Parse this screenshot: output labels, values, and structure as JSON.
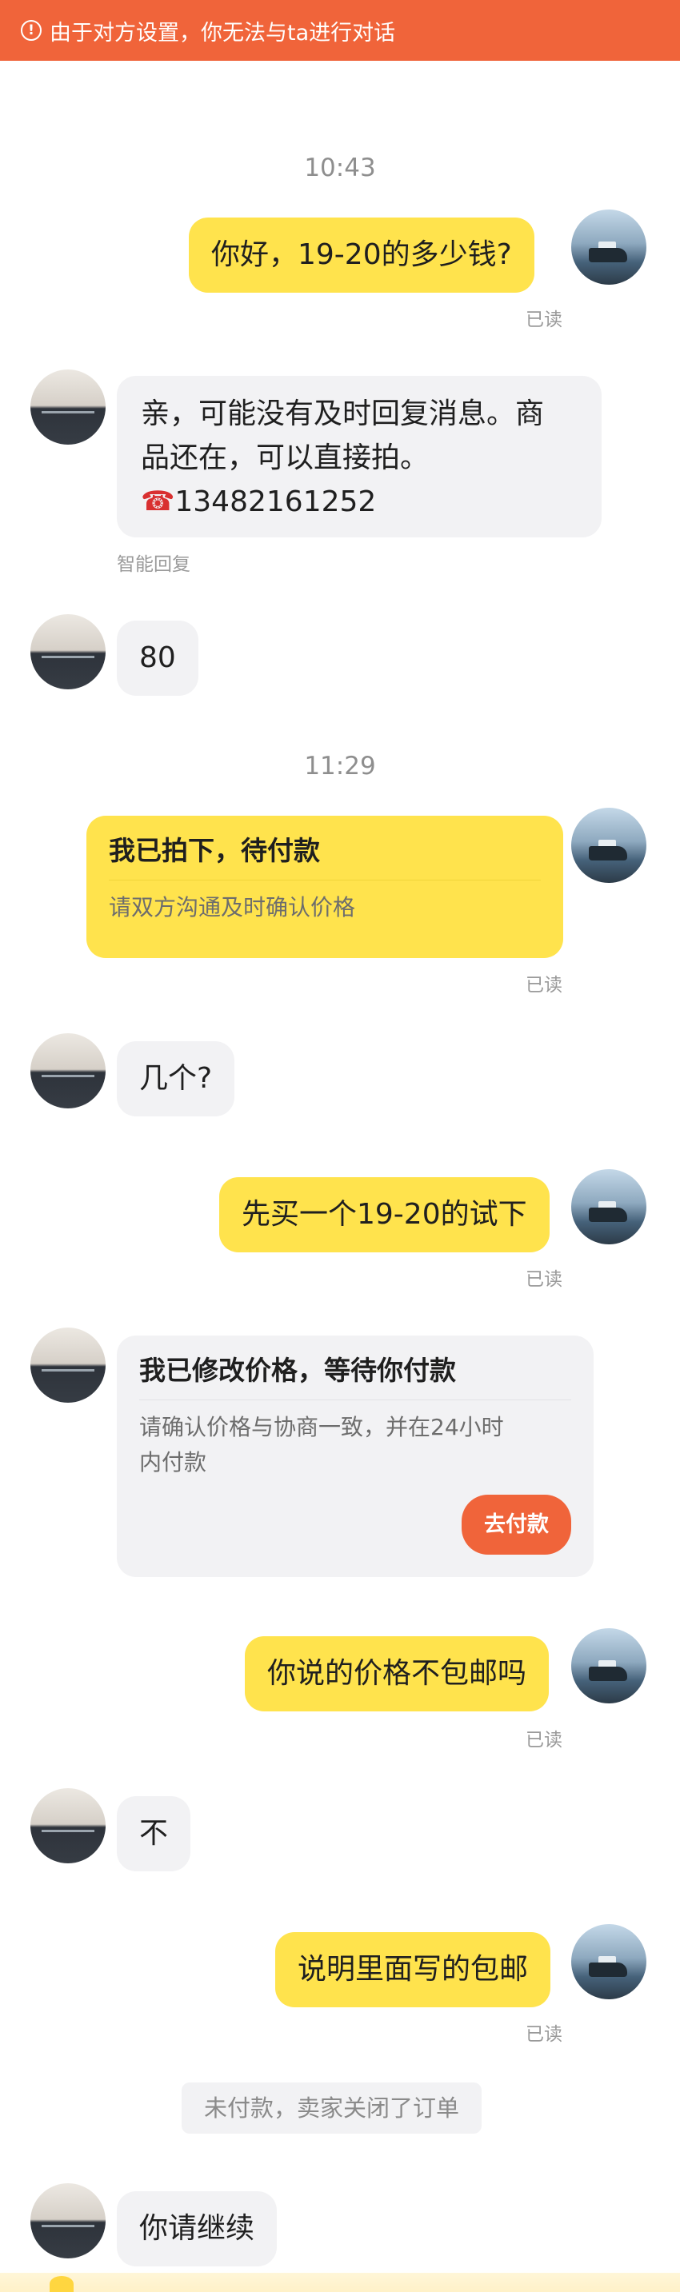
{
  "banner": {
    "icon": "alert-circle-icon",
    "text": "由于对方设置，你无法与ta进行对话"
  },
  "colors": {
    "banner": "#f0643a",
    "my_bubble": "#ffe34d",
    "their_bubble": "#f2f2f4",
    "pay_button": "#f0643a"
  },
  "messages": {
    "time1": "10:43",
    "m1": {
      "text": "你好，19-20的多少钱?",
      "status": "已读"
    },
    "m2": {
      "line1": "亲，可能没有及时回复消息。商",
      "line2": "品还在，可以直接拍。",
      "phone_icon": "telephone-icon",
      "phone": "13482161252",
      "note": "智能回复"
    },
    "m3": {
      "text": "80"
    },
    "time2": "11:29",
    "m4": {
      "title": "我已拍下，待付款",
      "subtitle": "请双方沟通及时确认价格",
      "status": "已读"
    },
    "m5": {
      "text": "几个?"
    },
    "m6": {
      "text": "先买一个19-20的试下",
      "status": "已读"
    },
    "m7": {
      "title": "我已修改价格，等待你付款",
      "sub_line1": "请确认价格与协商一致，并在24小时",
      "sub_line2": "内付款",
      "button": "去付款"
    },
    "m8": {
      "text": "你说的价格不包邮吗",
      "status": "已读"
    },
    "m9": {
      "text": "不"
    },
    "m10": {
      "text": "说明里面写的包邮",
      "status": "已读"
    },
    "notice": "未付款，卖家关闭了订单",
    "m11": {
      "text": "你请继续"
    }
  }
}
